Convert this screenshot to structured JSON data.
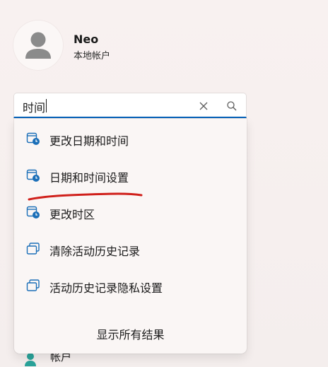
{
  "profile": {
    "name": "Neo",
    "account_type": "本地帐户"
  },
  "search": {
    "value": "时间"
  },
  "results": [
    {
      "label": "更改日期和时间",
      "icon": "calendar-clock-icon"
    },
    {
      "label": "日期和时间设置",
      "icon": "calendar-clock-icon"
    },
    {
      "label": "更改时区",
      "icon": "calendar-clock-icon"
    },
    {
      "label": "清除活动历史记录",
      "icon": "copy-windows-icon"
    },
    {
      "label": "活动历史记录隐私设置",
      "icon": "copy-windows-icon"
    }
  ],
  "show_all_label": "显示所有结果",
  "behind_nav": {
    "label": "帐户"
  },
  "colors": {
    "accent": "#005fb8",
    "annotation": "#d0201b",
    "behind_icon": "#2aa39a"
  }
}
